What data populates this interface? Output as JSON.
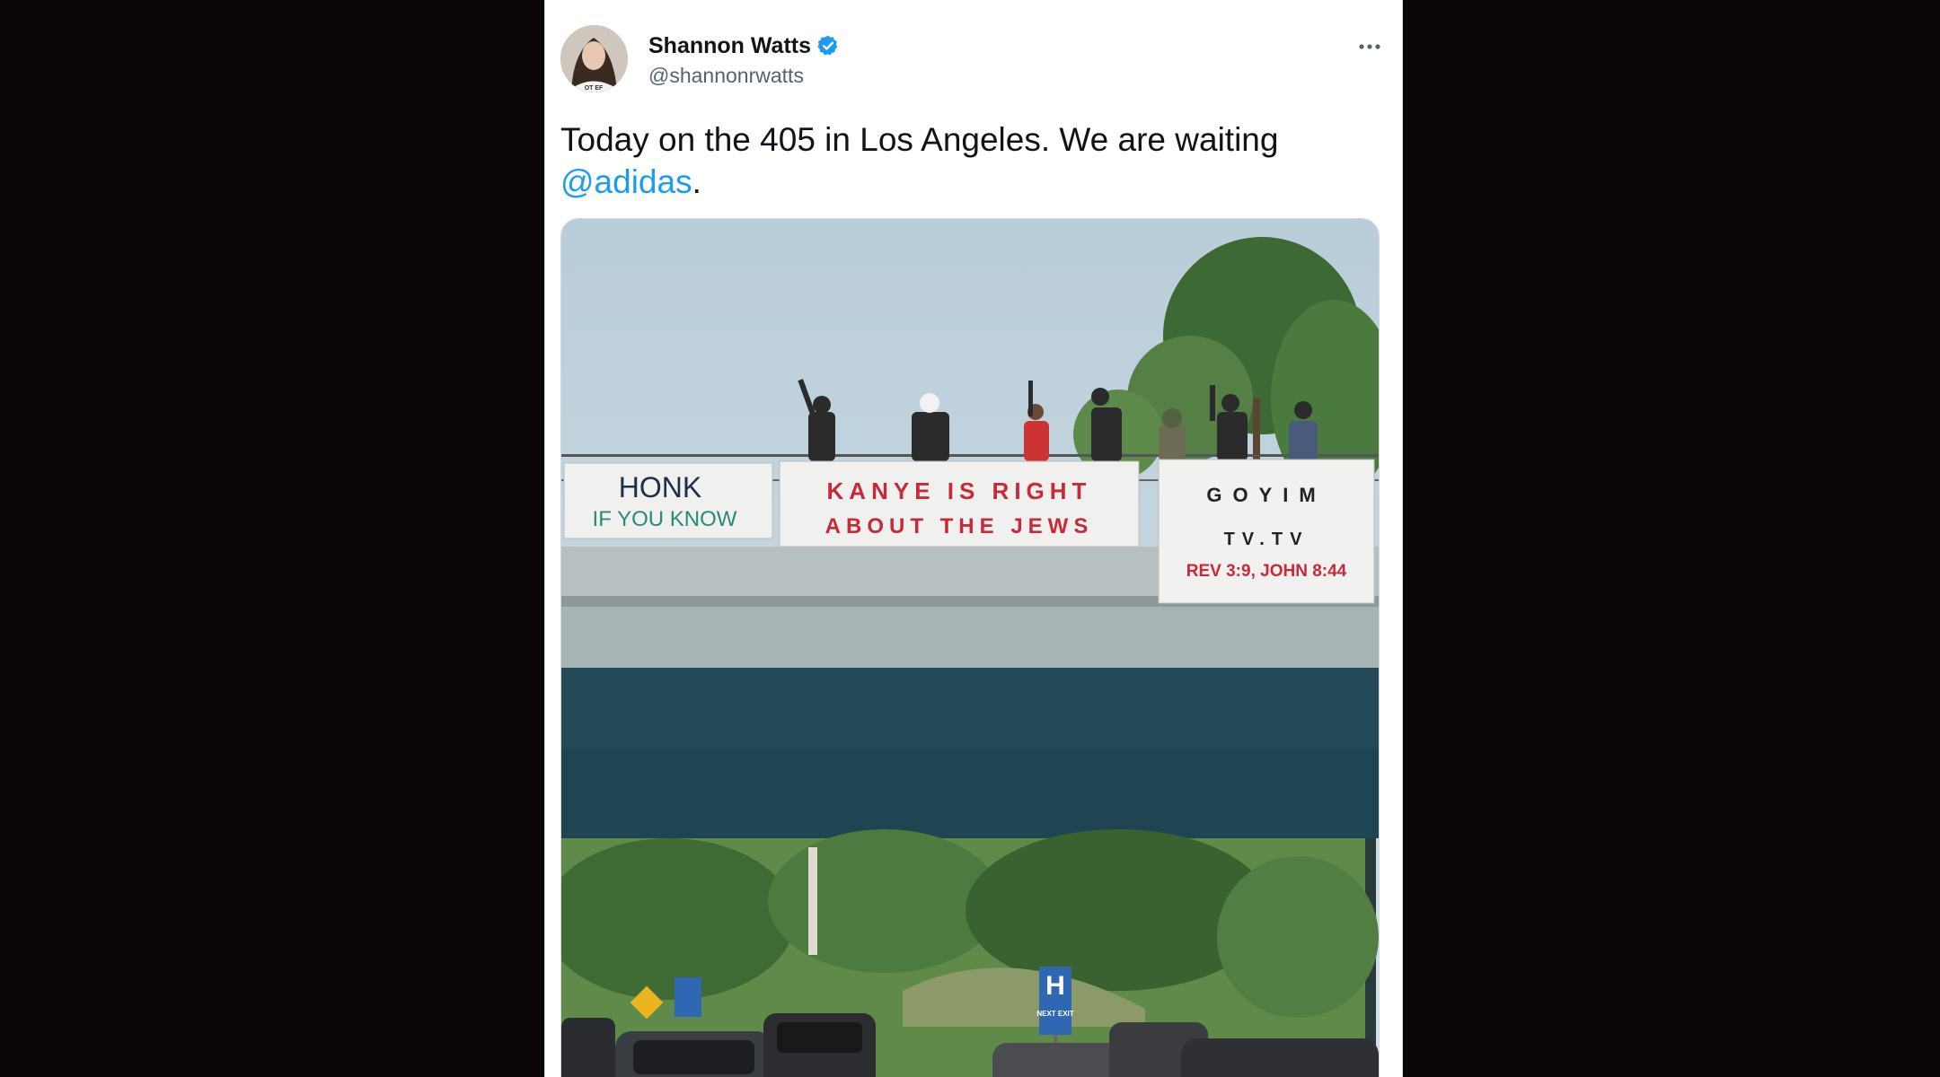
{
  "tweet": {
    "author": {
      "display_name": "Shannon Watts",
      "handle": "@shannonrwatts",
      "verified": true,
      "avatar_icon": "profile-photo",
      "avatar_shirt_text": "OT EF"
    },
    "more_icon": "more-horizontal-icon",
    "text_before": "Today on the 405 in Los Angeles. We are waiting",
    "mention": "@adidas",
    "text_after": ".",
    "colors": {
      "mention": "#1d9bf0",
      "verified": "#1d9bf0",
      "text": "#0f1419",
      "secondary": "#536471",
      "background_outside": "#0b0406"
    },
    "image": {
      "banners": {
        "left_line1": "HONK",
        "left_line2": "IF YOU KNOW",
        "center_line1": "KANYE IS RIGHT",
        "center_line2": "ABOUT THE JEWS",
        "right_line1": "GOYIM",
        "right_line2": "TV.TV",
        "right_line3": "REV 3:9, JOHN 8:44"
      },
      "signs": {
        "hospital": "H",
        "next_exit": "NEXT EXIT"
      }
    }
  }
}
